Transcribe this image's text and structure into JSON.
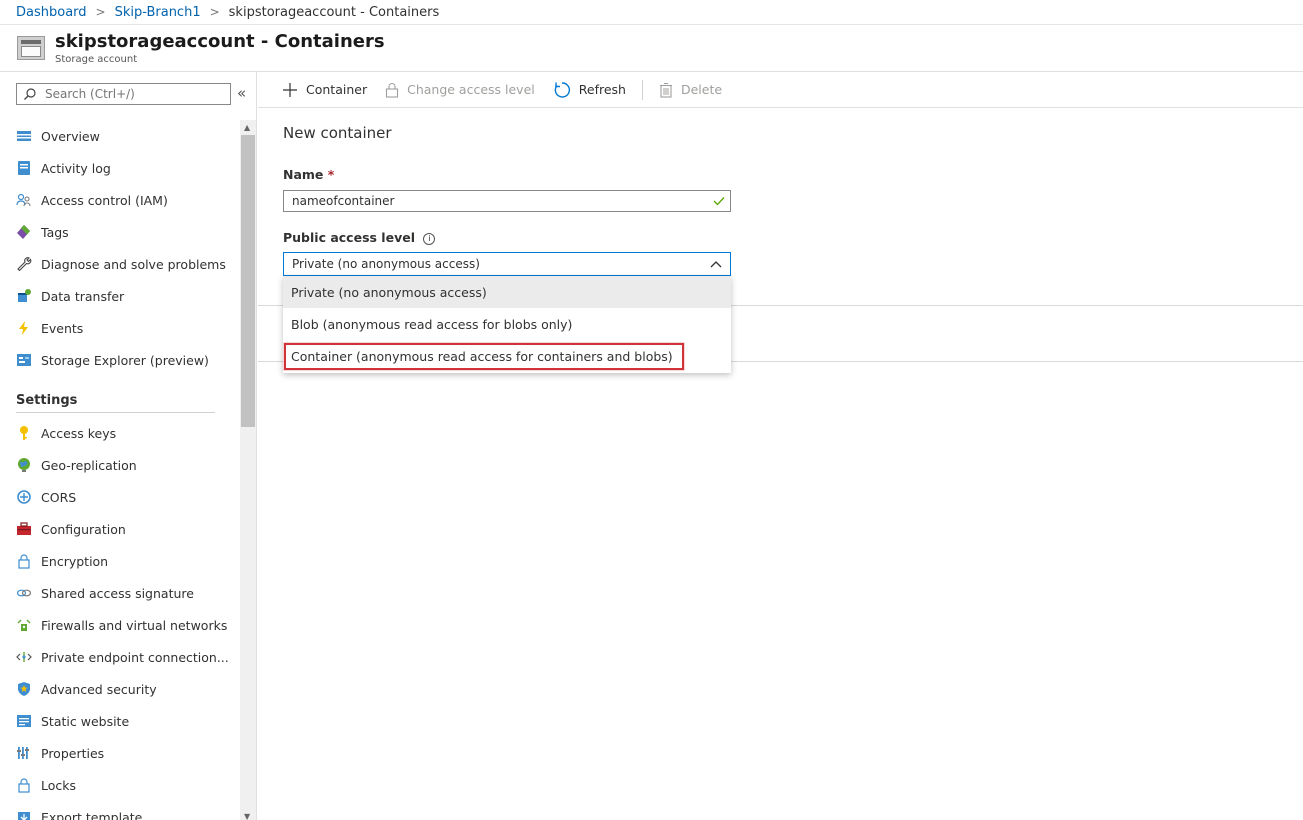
{
  "breadcrumb": {
    "items": [
      "Dashboard",
      "Skip-Branch1"
    ],
    "current": "skipstorageaccount - Containers"
  },
  "header": {
    "title": "skipstorageaccount - Containers",
    "subtitle": "Storage account"
  },
  "sidebar": {
    "search_placeholder": "Search (Ctrl+/)",
    "collapse_icon": "«",
    "items": [
      {
        "label": "Overview",
        "icon": "overview-icon"
      },
      {
        "label": "Activity log",
        "icon": "activity-log-icon"
      },
      {
        "label": "Access control (IAM)",
        "icon": "people-icon"
      },
      {
        "label": "Tags",
        "icon": "tag-icon"
      },
      {
        "label": "Diagnose and solve problems",
        "icon": "wrench-icon"
      },
      {
        "label": "Data transfer",
        "icon": "data-transfer-icon"
      },
      {
        "label": "Events",
        "icon": "lightning-icon"
      },
      {
        "label": "Storage Explorer (preview)",
        "icon": "storage-explorer-icon"
      }
    ],
    "settings_title": "Settings",
    "settings_items": [
      {
        "label": "Access keys",
        "icon": "key-icon"
      },
      {
        "label": "Geo-replication",
        "icon": "globe-icon"
      },
      {
        "label": "CORS",
        "icon": "cors-icon"
      },
      {
        "label": "Configuration",
        "icon": "toolbox-icon"
      },
      {
        "label": "Encryption",
        "icon": "lock-icon"
      },
      {
        "label": "Shared access signature",
        "icon": "link-icon"
      },
      {
        "label": "Firewalls and virtual networks",
        "icon": "firewall-icon"
      },
      {
        "label": "Private endpoint connection...",
        "icon": "endpoint-icon"
      },
      {
        "label": "Advanced security",
        "icon": "shield-icon"
      },
      {
        "label": "Static website",
        "icon": "website-icon"
      },
      {
        "label": "Properties",
        "icon": "properties-icon"
      },
      {
        "label": "Locks",
        "icon": "lock-icon"
      },
      {
        "label": "Export template",
        "icon": "export-icon"
      }
    ]
  },
  "toolbar": {
    "container_label": "Container",
    "change_access_label": "Change access level",
    "refresh_label": "Refresh",
    "delete_label": "Delete"
  },
  "panel": {
    "title": "New container",
    "name_label": "Name",
    "required_mark": "*",
    "name_value": "nameofcontainer",
    "access_label": "Public access level",
    "info_glyph": "i",
    "access_selected": "Private (no anonymous access)",
    "options": [
      "Private (no anonymous access)",
      "Blob (anonymous read access for blobs only)",
      "Container (anonymous read access for containers and blobs)"
    ]
  },
  "colors": {
    "link": "#0062ad",
    "accent": "#0078d4",
    "highlight_border": "#d13438",
    "check": "#57a300"
  }
}
